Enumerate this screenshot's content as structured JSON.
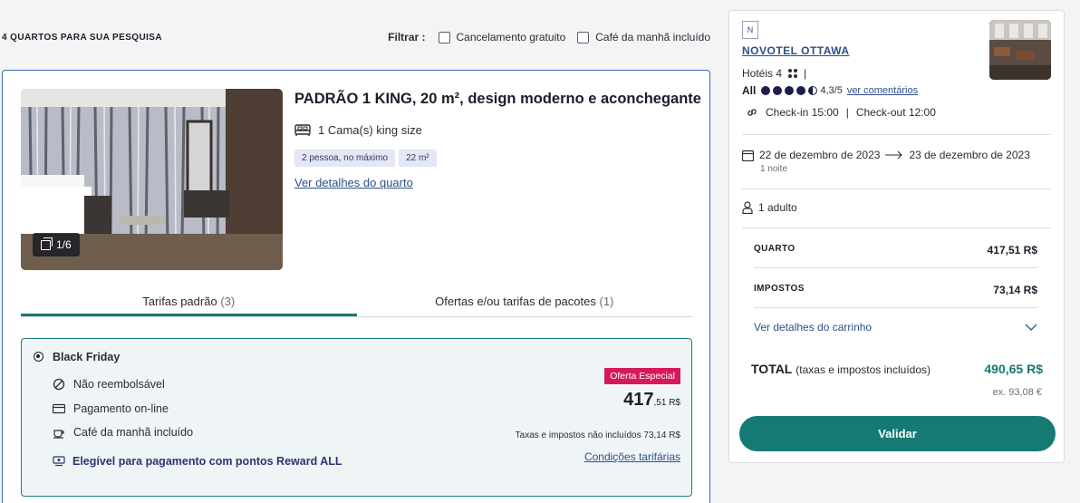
{
  "results": {
    "count_label": "4 QUARTOS PARA SUA PESQUISA"
  },
  "filter": {
    "label": "Filtrar :",
    "options": [
      {
        "label": "Cancelamento gratuito",
        "checked": false
      },
      {
        "label": "Café da manhã incluído",
        "checked": false
      }
    ]
  },
  "room": {
    "title": "PADRÃO 1 KING, 20 m², design moderno e aconchegante",
    "photo_counter": "1/6",
    "bed": "1 Cama(s) king size",
    "tags": [
      "2 pessoa, no máximo",
      "22 m²"
    ],
    "details_link": "Ver detalhes do quarto",
    "tabs": [
      {
        "label": "Tarifas padrão",
        "count": "(3)",
        "active": true
      },
      {
        "label": "Ofertas e/ou tarifas de pacotes",
        "count": "(1)",
        "active": false
      }
    ],
    "rate": {
      "name": "Black Friday",
      "features": [
        {
          "icon": "no-refund-icon",
          "label": "Não reembolsável"
        },
        {
          "icon": "card-icon",
          "label": "Pagamento on-line"
        },
        {
          "icon": "breakfast-icon",
          "label": "Café da manhã incluído"
        }
      ],
      "reward": "Elegível para pagamento com pontos Reward ALL",
      "badge": "Oferta Especial",
      "price_int": "417",
      "price_dec": ",51 R$",
      "tax_note": "Taxas e impostos não incluídos 73,14 R$",
      "conditions_link": "Condições tarifárias"
    }
  },
  "summary": {
    "brand_logo": "N",
    "hotel_name": "NOVOTEL OTTAWA",
    "category": "Hotéis 4",
    "rating_brand": "All",
    "rating_score": "4,3/5",
    "rating_value": 4.3,
    "reviews_link": "ver comentários",
    "checkin": "Check-in 15:00",
    "checkout": "Check-out 12:00",
    "date_from": "22 de dezembro de 2023",
    "date_to": "23 de dezembro de 2023",
    "nights": "1 noite",
    "guests": "1 adulto",
    "lines": [
      {
        "label": "QUARTO",
        "amount": "417,51 R$"
      },
      {
        "label": "IMPOSTOS",
        "amount": "73,14 R$"
      }
    ],
    "cart_link": "Ver detalhes do carrinho",
    "total_label": "TOTAL",
    "total_note": "(taxas e impostos incluídos)",
    "total_amount": "490,65 R$",
    "ex_amount": "ex. 93,08 €",
    "validate_label": "Validar"
  },
  "colors": {
    "accent": "#147a73",
    "link": "#2c4f8a",
    "badge": "#d6195a",
    "card_border": "#3a6db0"
  }
}
